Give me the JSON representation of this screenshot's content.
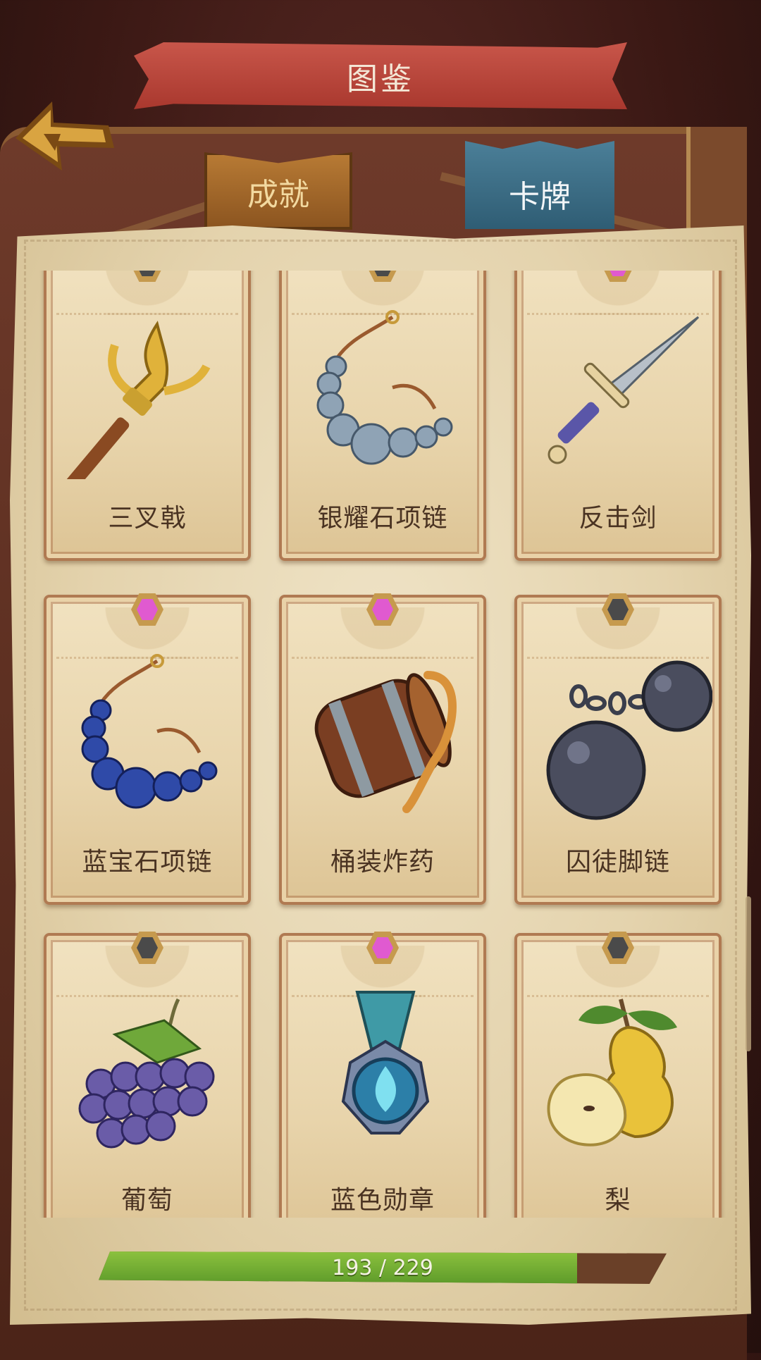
{
  "header": {
    "title": "图鉴"
  },
  "tabs": [
    {
      "label": "成就",
      "active": false
    },
    {
      "label": "卡牌",
      "active": true
    }
  ],
  "colors": {
    "rarity_gray": "#4a4a4a",
    "rarity_pink": "#e05ad0",
    "progress_fill": "#6fae33",
    "tab_active": "#3f6f87"
  },
  "cards": [
    {
      "name": "三叉戟",
      "rarity": "gray",
      "icon": "trident-icon"
    },
    {
      "name": "银耀石项链",
      "rarity": "gray",
      "icon": "silver-necklace-icon"
    },
    {
      "name": "反击剑",
      "rarity": "pink",
      "icon": "dagger-icon"
    },
    {
      "name": "蓝宝石项链",
      "rarity": "pink",
      "icon": "sapphire-necklace-icon"
    },
    {
      "name": "桶装炸药",
      "rarity": "pink",
      "icon": "powder-barrel-icon"
    },
    {
      "name": "囚徒脚链",
      "rarity": "gray",
      "icon": "ball-and-chain-icon"
    },
    {
      "name": "葡萄",
      "rarity": "gray",
      "icon": "grapes-icon"
    },
    {
      "name": "蓝色勋章",
      "rarity": "pink",
      "icon": "blue-medal-icon"
    },
    {
      "name": "梨",
      "rarity": "gray",
      "icon": "pear-icon"
    }
  ],
  "progress": {
    "label": "193 / 229",
    "current": 193,
    "total": 229
  }
}
